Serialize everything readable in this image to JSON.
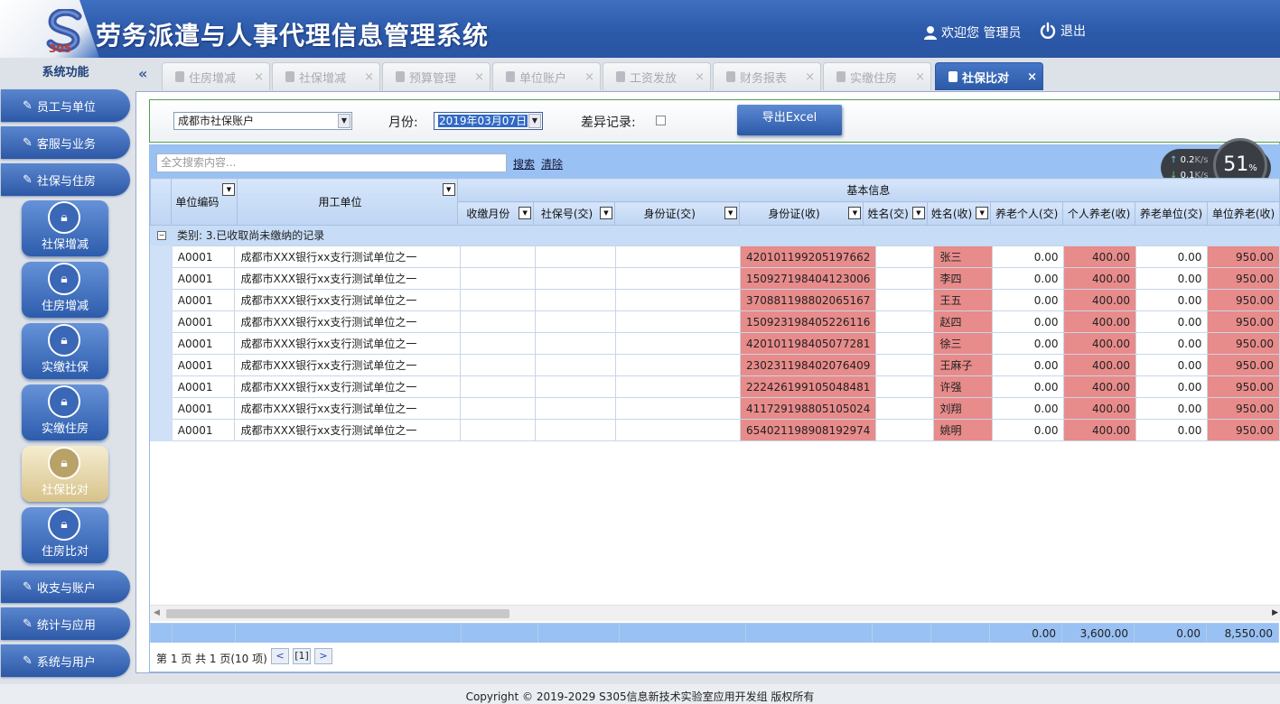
{
  "header": {
    "app_title": "劳务派遣与人事代理信息管理系统",
    "logo_text": "305",
    "welcome": "欢迎您 管理员",
    "logout": "退出"
  },
  "sidebar": {
    "title": "系统功能",
    "groups": [
      {
        "label": "员工与单位"
      },
      {
        "label": "客服与业务"
      },
      {
        "label": "社保与住房"
      },
      {
        "label": "收支与账户"
      },
      {
        "label": "统计与应用"
      },
      {
        "label": "系统与用户"
      }
    ],
    "tiles": [
      {
        "label": "社保增减"
      },
      {
        "label": "住房增减"
      },
      {
        "label": "实缴社保"
      },
      {
        "label": "实缴住房"
      },
      {
        "label": "社保比对"
      },
      {
        "label": "住房比对"
      }
    ]
  },
  "tabs": [
    {
      "label": "住房增减"
    },
    {
      "label": "社保增减"
    },
    {
      "label": "预算管理"
    },
    {
      "label": "单位账户"
    },
    {
      "label": "工资发放"
    },
    {
      "label": "财务报表"
    },
    {
      "label": "实缴住房"
    },
    {
      "label": "社保比对"
    }
  ],
  "filter": {
    "account_value": "成都市社保账户",
    "month_label": "月份:",
    "month_value": "2019年03月07日",
    "diff_label": "差异记录:",
    "export_label": "导出Excel"
  },
  "search": {
    "placeholder": "全文搜索内容...",
    "search_link": "搜索",
    "clear_link": "清除"
  },
  "speed": {
    "up": "0.2",
    "down": "0.1",
    "unit": "K/s",
    "percent": "51",
    "percent_unit": "%"
  },
  "grid": {
    "group_header": "基本信息",
    "columns": [
      "单位编码",
      "用工单位",
      "收缴月份",
      "社保号(交)",
      "身份证(交)",
      "身份证(收)",
      "姓名(交)",
      "姓名(收)",
      "养老个人(交)",
      "个人养老(收)",
      "养老单位(交)",
      "单位养老(收)"
    ],
    "group_row": "类别: 3.已收取尚未缴纳的记录",
    "rows": [
      {
        "code": "A0001",
        "unit": "成都市XXX银行xx支行测试单位之一",
        "id_recv": "420101199205197662",
        "name_recv": "张三",
        "p_pay": "0.00",
        "p_recv": "400.00",
        "u_pay": "0.00",
        "u_recv": "950.00"
      },
      {
        "code": "A0001",
        "unit": "成都市XXX银行xx支行测试单位之一",
        "id_recv": "150927198404123006",
        "name_recv": "李四",
        "p_pay": "0.00",
        "p_recv": "400.00",
        "u_pay": "0.00",
        "u_recv": "950.00"
      },
      {
        "code": "A0001",
        "unit": "成都市XXX银行xx支行测试单位之一",
        "id_recv": "370881198802065167",
        "name_recv": "王五",
        "p_pay": "0.00",
        "p_recv": "400.00",
        "u_pay": "0.00",
        "u_recv": "950.00"
      },
      {
        "code": "A0001",
        "unit": "成都市XXX银行xx支行测试单位之一",
        "id_recv": "150923198405226116",
        "name_recv": "赵四",
        "p_pay": "0.00",
        "p_recv": "400.00",
        "u_pay": "0.00",
        "u_recv": "950.00"
      },
      {
        "code": "A0001",
        "unit": "成都市XXX银行xx支行测试单位之一",
        "id_recv": "420101198405077281",
        "name_recv": "徐三",
        "p_pay": "0.00",
        "p_recv": "400.00",
        "u_pay": "0.00",
        "u_recv": "950.00"
      },
      {
        "code": "A0001",
        "unit": "成都市XXX银行xx支行测试单位之一",
        "id_recv": "230231198402076409",
        "name_recv": "王麻子",
        "p_pay": "0.00",
        "p_recv": "400.00",
        "u_pay": "0.00",
        "u_recv": "950.00"
      },
      {
        "code": "A0001",
        "unit": "成都市XXX银行xx支行测试单位之一",
        "id_recv": "222426199105048481",
        "name_recv": "许强",
        "p_pay": "0.00",
        "p_recv": "400.00",
        "u_pay": "0.00",
        "u_recv": "950.00"
      },
      {
        "code": "A0001",
        "unit": "成都市XXX银行xx支行测试单位之一",
        "id_recv": "411729198805105024",
        "name_recv": "刘翔",
        "p_pay": "0.00",
        "p_recv": "400.00",
        "u_pay": "0.00",
        "u_recv": "950.00"
      },
      {
        "code": "A0001",
        "unit": "成都市XXX银行xx支行测试单位之一",
        "id_recv": "654021198908192974",
        "name_recv": "姚明",
        "p_pay": "0.00",
        "p_recv": "400.00",
        "u_pay": "0.00",
        "u_recv": "950.00"
      }
    ],
    "totals": {
      "p_pay": "0.00",
      "p_recv": "3,600.00",
      "u_pay": "0.00",
      "u_recv": "8,550.00"
    }
  },
  "pager": {
    "summary": "第 1 页 共 1 页(10 项)",
    "current": "[1]"
  },
  "footer": {
    "copyright": "Copyright © 2019-2029 S305信息新技术实验室应用开发组 版权所有"
  }
}
